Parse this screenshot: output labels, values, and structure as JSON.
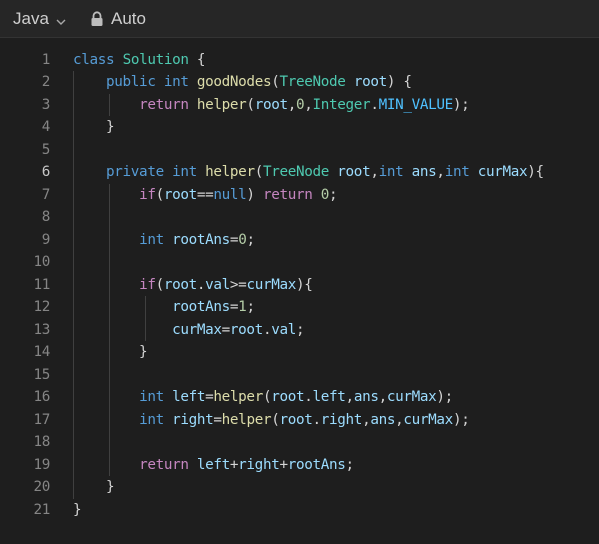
{
  "toolbar": {
    "language": "Java",
    "mode": "Auto",
    "language_icon": "chevron-down-icon",
    "mode_icon": "lock-icon"
  },
  "editor": {
    "active_line": 6,
    "colors": {
      "background": "#1e1e1e",
      "keyword": "#569cd6",
      "control": "#c586c0",
      "type": "#4ec9b0",
      "function": "#dcdcaa",
      "variable": "#9cdcfe",
      "number": "#b5cea8",
      "constant": "#4fc1ff",
      "plain": "#d4d4d4",
      "line_number": "#858585"
    },
    "lines": [
      {
        "n": "1",
        "tokens": [
          [
            "kw",
            "class"
          ],
          [
            "pl",
            " "
          ],
          [
            "ty",
            "Solution"
          ],
          [
            "pl",
            " {"
          ]
        ]
      },
      {
        "n": "2",
        "tokens": [
          [
            "pl",
            "    "
          ],
          [
            "kw",
            "public"
          ],
          [
            "pl",
            " "
          ],
          [
            "kw",
            "int"
          ],
          [
            "pl",
            " "
          ],
          [
            "fn",
            "goodNodes"
          ],
          [
            "pl",
            "("
          ],
          [
            "ty",
            "TreeNode"
          ],
          [
            "pl",
            " "
          ],
          [
            "var",
            "root"
          ],
          [
            "pl",
            ") {"
          ]
        ]
      },
      {
        "n": "3",
        "tokens": [
          [
            "pl",
            "        "
          ],
          [
            "ctl",
            "return"
          ],
          [
            "pl",
            " "
          ],
          [
            "fn",
            "helper"
          ],
          [
            "pl",
            "("
          ],
          [
            "var",
            "root"
          ],
          [
            "pl",
            ","
          ],
          [
            "num",
            "0"
          ],
          [
            "pl",
            ","
          ],
          [
            "ty",
            "Integer"
          ],
          [
            "pl",
            "."
          ],
          [
            "cst",
            "MIN_VALUE"
          ],
          [
            "pl",
            ");"
          ]
        ]
      },
      {
        "n": "4",
        "tokens": [
          [
            "pl",
            "    }"
          ]
        ]
      },
      {
        "n": "5",
        "tokens": []
      },
      {
        "n": "6",
        "tokens": [
          [
            "pl",
            "    "
          ],
          [
            "kw",
            "private"
          ],
          [
            "pl",
            " "
          ],
          [
            "kw",
            "int"
          ],
          [
            "pl",
            " "
          ],
          [
            "fn",
            "helper"
          ],
          [
            "pl",
            "("
          ],
          [
            "ty",
            "TreeNode"
          ],
          [
            "pl",
            " "
          ],
          [
            "var",
            "root"
          ],
          [
            "pl",
            ","
          ],
          [
            "kw",
            "int"
          ],
          [
            "pl",
            " "
          ],
          [
            "var",
            "ans"
          ],
          [
            "pl",
            ","
          ],
          [
            "kw",
            "int"
          ],
          [
            "pl",
            " "
          ],
          [
            "var",
            "curMax"
          ],
          [
            "pl",
            "){"
          ]
        ]
      },
      {
        "n": "7",
        "tokens": [
          [
            "pl",
            "        "
          ],
          [
            "ctl",
            "if"
          ],
          [
            "pl",
            "("
          ],
          [
            "var",
            "root"
          ],
          [
            "pl",
            "=="
          ],
          [
            "kw",
            "null"
          ],
          [
            "pl",
            ") "
          ],
          [
            "ctl",
            "return"
          ],
          [
            "pl",
            " "
          ],
          [
            "num",
            "0"
          ],
          [
            "pl",
            ";"
          ]
        ]
      },
      {
        "n": "8",
        "tokens": []
      },
      {
        "n": "9",
        "tokens": [
          [
            "pl",
            "        "
          ],
          [
            "kw",
            "int"
          ],
          [
            "pl",
            " "
          ],
          [
            "var",
            "rootAns"
          ],
          [
            "pl",
            "="
          ],
          [
            "num",
            "0"
          ],
          [
            "pl",
            ";"
          ]
        ]
      },
      {
        "n": "10",
        "tokens": []
      },
      {
        "n": "11",
        "tokens": [
          [
            "pl",
            "        "
          ],
          [
            "ctl",
            "if"
          ],
          [
            "pl",
            "("
          ],
          [
            "var",
            "root"
          ],
          [
            "pl",
            "."
          ],
          [
            "var",
            "val"
          ],
          [
            "pl",
            ">="
          ],
          [
            "var",
            "curMax"
          ],
          [
            "pl",
            "){"
          ]
        ]
      },
      {
        "n": "12",
        "tokens": [
          [
            "pl",
            "            "
          ],
          [
            "var",
            "rootAns"
          ],
          [
            "pl",
            "="
          ],
          [
            "num",
            "1"
          ],
          [
            "pl",
            ";"
          ]
        ]
      },
      {
        "n": "13",
        "tokens": [
          [
            "pl",
            "            "
          ],
          [
            "var",
            "curMax"
          ],
          [
            "pl",
            "="
          ],
          [
            "var",
            "root"
          ],
          [
            "pl",
            "."
          ],
          [
            "var",
            "val"
          ],
          [
            "pl",
            ";"
          ]
        ]
      },
      {
        "n": "14",
        "tokens": [
          [
            "pl",
            "        }"
          ]
        ]
      },
      {
        "n": "15",
        "tokens": []
      },
      {
        "n": "16",
        "tokens": [
          [
            "pl",
            "        "
          ],
          [
            "kw",
            "int"
          ],
          [
            "pl",
            " "
          ],
          [
            "var",
            "left"
          ],
          [
            "pl",
            "="
          ],
          [
            "fn",
            "helper"
          ],
          [
            "pl",
            "("
          ],
          [
            "var",
            "root"
          ],
          [
            "pl",
            "."
          ],
          [
            "var",
            "left"
          ],
          [
            "pl",
            ","
          ],
          [
            "var",
            "ans"
          ],
          [
            "pl",
            ","
          ],
          [
            "var",
            "curMax"
          ],
          [
            "pl",
            ");"
          ]
        ]
      },
      {
        "n": "17",
        "tokens": [
          [
            "pl",
            "        "
          ],
          [
            "kw",
            "int"
          ],
          [
            "pl",
            " "
          ],
          [
            "var",
            "right"
          ],
          [
            "pl",
            "="
          ],
          [
            "fn",
            "helper"
          ],
          [
            "pl",
            "("
          ],
          [
            "var",
            "root"
          ],
          [
            "pl",
            "."
          ],
          [
            "var",
            "right"
          ],
          [
            "pl",
            ","
          ],
          [
            "var",
            "ans"
          ],
          [
            "pl",
            ","
          ],
          [
            "var",
            "curMax"
          ],
          [
            "pl",
            ");"
          ]
        ]
      },
      {
        "n": "18",
        "tokens": []
      },
      {
        "n": "19",
        "tokens": [
          [
            "pl",
            "        "
          ],
          [
            "ctl",
            "return"
          ],
          [
            "pl",
            " "
          ],
          [
            "var",
            "left"
          ],
          [
            "pl",
            "+"
          ],
          [
            "var",
            "right"
          ],
          [
            "pl",
            "+"
          ],
          [
            "var",
            "rootAns"
          ],
          [
            "pl",
            ";"
          ]
        ]
      },
      {
        "n": "20",
        "tokens": [
          [
            "pl",
            "    }"
          ]
        ]
      },
      {
        "n": "21",
        "tokens": [
          [
            "pl",
            "}"
          ]
        ]
      }
    ]
  }
}
